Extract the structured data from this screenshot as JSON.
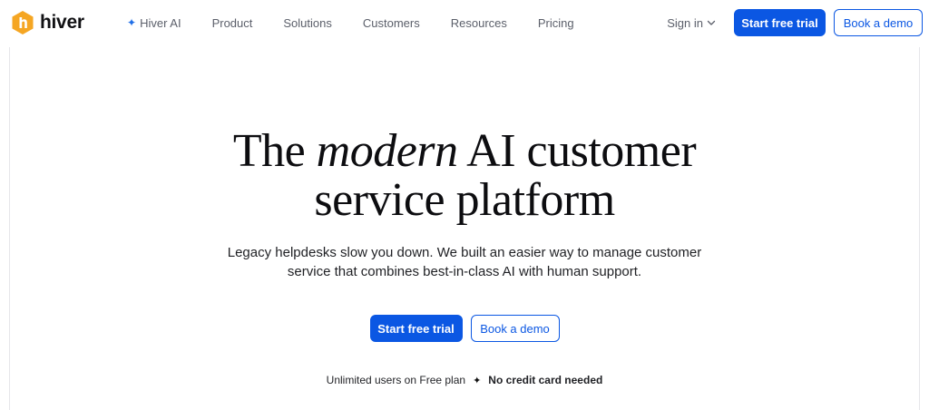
{
  "brand": {
    "name": "hiver",
    "logo_icon": "hiver-hexagon-logo",
    "accent": "#0b57e3",
    "logo_color": "#f5a623"
  },
  "nav": {
    "links": [
      {
        "label": "Hiver AI",
        "icon": "sparkle-icon"
      },
      {
        "label": "Product"
      },
      {
        "label": "Solutions"
      },
      {
        "label": "Customers"
      },
      {
        "label": "Resources"
      },
      {
        "label": "Pricing"
      }
    ],
    "signin_label": "Sign in",
    "primary_cta": "Start free trial",
    "secondary_cta": "Book a demo"
  },
  "hero": {
    "headline_before": "The ",
    "headline_emphasis": "modern",
    "headline_after_line1": " AI customer",
    "headline_line2": "service platform",
    "subtext": "Legacy helpdesks slow you down. We built an easier way to manage customer service that combines best-in-class AI with human support.",
    "primary_cta": "Start free trial",
    "secondary_cta": "Book a demo",
    "footnote_left": "Unlimited users on Free plan",
    "footnote_separator": "✦",
    "footnote_right": "No credit card needed"
  }
}
